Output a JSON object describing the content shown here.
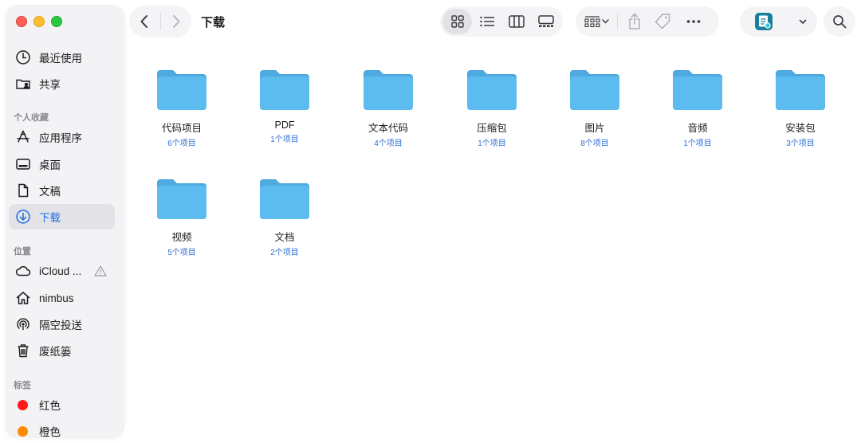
{
  "window": {
    "title": "下载"
  },
  "sidebar": {
    "items_top": [
      {
        "label": "最近使用",
        "icon": "clock-icon"
      },
      {
        "label": "共享",
        "icon": "shared-folder-icon"
      }
    ],
    "favorites_header": "个人收藏",
    "favorites": [
      {
        "label": "应用程序",
        "icon": "applications-icon"
      },
      {
        "label": "桌面",
        "icon": "desktop-icon"
      },
      {
        "label": "文稿",
        "icon": "document-icon"
      },
      {
        "label": "下载",
        "icon": "download-icon",
        "active": true
      }
    ],
    "locations_header": "位置",
    "locations": [
      {
        "label": "iCloud ...",
        "icon": "cloud-icon"
      },
      {
        "label": "nimbus",
        "icon": "home-icon"
      },
      {
        "label": "隔空投送",
        "icon": "airdrop-icon"
      },
      {
        "label": "废纸篓",
        "icon": "trash-icon"
      }
    ],
    "tags_header": "标签",
    "tags": [
      {
        "label": "红色",
        "color": "#ff1a1a"
      },
      {
        "label": "橙色",
        "color": "#ff8a00"
      }
    ]
  },
  "folders": [
    {
      "name": "代码项目",
      "count": "6个项目"
    },
    {
      "name": "PDF",
      "count": "1个项目"
    },
    {
      "name": "文本代码",
      "count": "4个项目"
    },
    {
      "name": "压缩包",
      "count": "1个项目"
    },
    {
      "name": "图片",
      "count": "8个项目"
    },
    {
      "name": "音频",
      "count": "1个项目"
    },
    {
      "name": "安装包",
      "count": "3个项目"
    },
    {
      "name": "视频",
      "count": "5个项目"
    },
    {
      "name": "文档",
      "count": "2个项目"
    }
  ],
  "colors": {
    "accent": "#1f6fe0",
    "folder": "#5bb8ee"
  }
}
